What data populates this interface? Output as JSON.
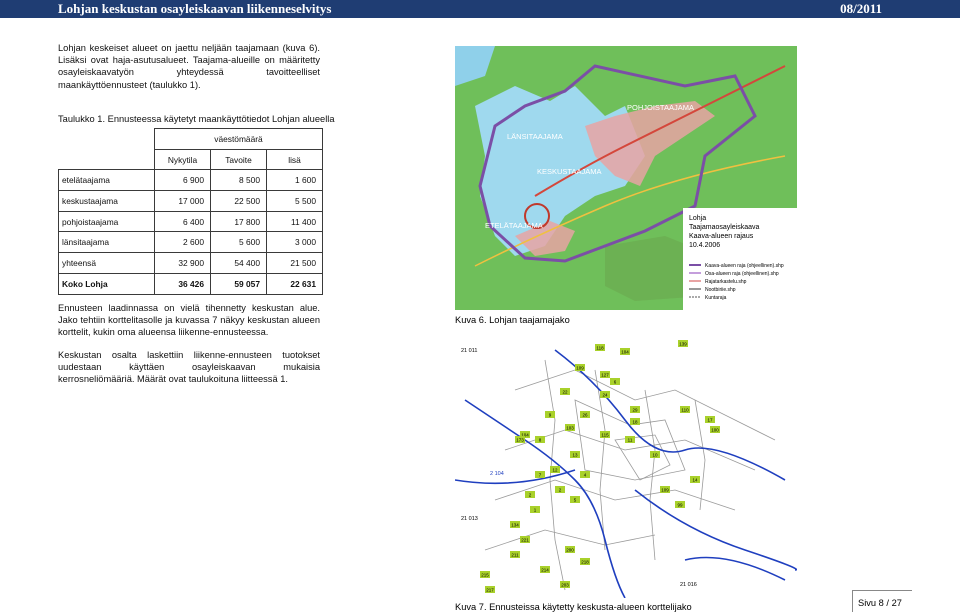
{
  "header": {
    "title": "Lohjan keskustan osayleiskaavan liikenneselvitys",
    "date": "08/2011"
  },
  "paragraphs": {
    "p1": "Lohjan keskeiset alueet on jaettu neljään taajamaan (kuva 6). Lisäksi ovat haja-asutusalueet. Taajama-alueille on määritetty osayleiskaavatyön yhteydessä tavoitteelliset maankäyttöennusteet (taulukko 1).",
    "p3": "Ennusteen laadinnassa on vielä tihennetty keskustan alue. Jako tehtiin korttelitasolle ja kuvassa 7 näkyy keskustan alueen korttelit, kukin oma alueensa liikenne-ennusteessa.",
    "p4": "Keskustan osalta laskettiin liikenne-ennusteen tuotokset uudestaan käyttäen osayleiskaavan mukaisia kerrosneliömääriä. Määrät ovat taulukoituna liitteessä 1."
  },
  "table_caption": "Taulukko 1. Ennusteessa käytetyt maankäyttötiedot Lohjan alueella",
  "table": {
    "group_header": "väestömäärä",
    "columns": [
      "Nykytila",
      "Tavoite",
      "lisä"
    ],
    "rows": [
      {
        "label": "etelätaajama",
        "values": [
          "6 900",
          "8 500",
          "1 600"
        ],
        "bold": false
      },
      {
        "label": "keskustaajama",
        "values": [
          "17 000",
          "22 500",
          "5 500"
        ],
        "bold": false
      },
      {
        "label": "pohjoistaajama",
        "values": [
          "6 400",
          "17 800",
          "11 400"
        ],
        "bold": false
      },
      {
        "label": "länsitaajama",
        "values": [
          "2 600",
          "5 600",
          "3 000"
        ],
        "bold": false
      },
      {
        "label": "yhteensä",
        "values": [
          "32 900",
          "54 400",
          "21 500"
        ],
        "bold": false
      },
      {
        "label": "Koko Lohja",
        "values": [
          "36 426",
          "59 057",
          "22 631"
        ],
        "bold": true
      }
    ]
  },
  "map1": {
    "labels": {
      "pohjoistaajama": "POHJOISTAAJAMA",
      "lansitaajama": "LÄNSITAAJAMA",
      "keskustaajama": "KESKUSTAAJAMA",
      "etelataajama": "ETELÄTAAJAMA"
    },
    "legend_title": [
      "Lohja",
      "Taajamaosayleiskaava",
      "Kaava-alueen rajaus",
      "10.4.2006"
    ],
    "legend_items": [
      "Kaava-alueen raja (ohjeellinen).shp",
      "Osa-alueen raja (ohjeellinen).shp",
      "Rajatarkastelu.shp",
      "Nootbiriie.shp",
      "Kuntaraja"
    ],
    "colors": {
      "land": "#6fbf5a",
      "water": "#9fd9ee",
      "boundary": "#7b4fa6",
      "urban": "#e8a3a3"
    }
  },
  "caption_map1": "Kuva 6. Lohjan taajamajako",
  "map2": {
    "labels": [
      "21 011",
      "2 104",
      "21 013",
      "21 016"
    ],
    "block_numbers": [
      "118",
      "104",
      "139",
      "109",
      "127",
      "6",
      "22",
      "24",
      "9",
      "26",
      "103",
      "29",
      "18",
      "110",
      "17",
      "104",
      "115",
      "173",
      "8",
      "13",
      "12",
      "4",
      "7",
      "2",
      "2",
      "5",
      "1",
      "11",
      "10",
      "109",
      "99",
      "14",
      "100",
      "134",
      "221",
      "211",
      "214",
      "200",
      "218",
      "215",
      "217",
      "203"
    ],
    "colors": {
      "road": "#1f3fbf",
      "block_fill": "#a9d12b",
      "block_line": "#9a9a9a"
    }
  },
  "caption_map2": "Kuva 7. Ennusteissa käytetty keskusta-alueen korttelijako",
  "page_number": "Sivu 8 / 27"
}
